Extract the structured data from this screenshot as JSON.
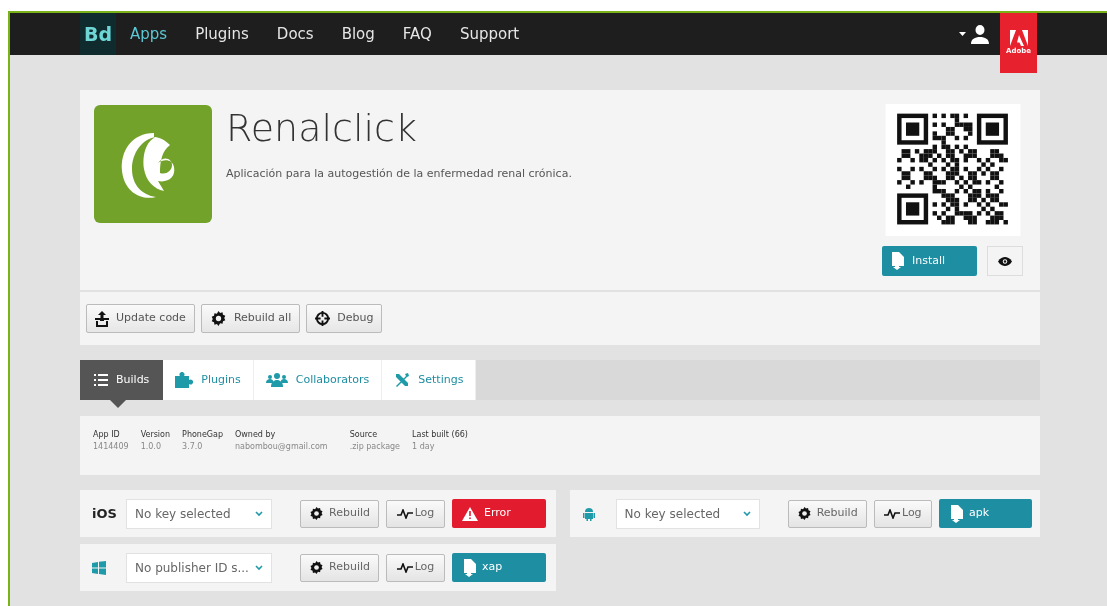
{
  "nav": {
    "logo": "Bd",
    "items": [
      {
        "label": "Apps",
        "selected": true
      },
      {
        "label": "Plugins",
        "selected": false
      },
      {
        "label": "Docs",
        "selected": false
      },
      {
        "label": "Blog",
        "selected": false
      },
      {
        "label": "FAQ",
        "selected": false
      },
      {
        "label": "Support",
        "selected": false
      }
    ],
    "brand": "Adobe"
  },
  "app": {
    "name": "Renalclick",
    "description": "Aplicación para la autogestión de la enfermedad renal crónica.",
    "install": "Install"
  },
  "actions": [
    {
      "kind": "upload",
      "label": "Update code"
    },
    {
      "kind": "rebuild",
      "label": "Rebuild all"
    },
    {
      "kind": "debug",
      "label": "Debug"
    }
  ],
  "tabs": [
    {
      "kind": "list",
      "label": "Builds",
      "selected": true
    },
    {
      "kind": "puzzle",
      "label": "Plugins",
      "selected": false
    },
    {
      "kind": "people",
      "label": "Collaborators",
      "selected": false
    },
    {
      "kind": "tools",
      "label": "Settings",
      "selected": false
    }
  ],
  "info": [
    {
      "label": "App ID",
      "value": "1414409"
    },
    {
      "label": "Version",
      "value": "1.0.0"
    },
    {
      "label": "PhoneGap",
      "value": "3.7.0"
    },
    {
      "label": "Owned by",
      "value": "nabombou@gmail.com"
    },
    {
      "label": "Source",
      "value": ".zip package"
    },
    {
      "label": "Last built (66)",
      "value": "1 day"
    }
  ],
  "platforms": [
    {
      "kind": "ios",
      "label": "iOS",
      "key": "No key selected",
      "rebuild": "Rebuild",
      "log": "Log",
      "status": {
        "kind": "error",
        "label": "Error"
      }
    },
    {
      "kind": "android",
      "key": "No key selected",
      "rebuild": "Rebuild",
      "log": "Log",
      "status": {
        "kind": "download",
        "label": "apk"
      }
    },
    {
      "kind": "windows",
      "key": "No publisher ID s...",
      "rebuild": "Rebuild",
      "log": "Log",
      "status": {
        "kind": "download",
        "label": "xap"
      }
    }
  ]
}
